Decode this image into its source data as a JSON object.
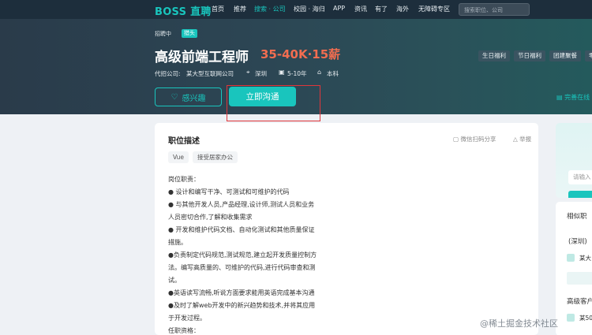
{
  "nav": {
    "logo": "BOSS 直聘",
    "items": [
      "首页",
      "推荐",
      "搜索 · 公司",
      "校园 · 海归",
      "APP",
      "资讯",
      "有了",
      "海外",
      "无障碍专区"
    ],
    "search_placeholder": "搜索职位、公司"
  },
  "job": {
    "status": "招聘中",
    "badge": "猎头",
    "title": "高级前端工程师",
    "salary": "35-40K·15薪",
    "company_label": "代招公司:",
    "company": "某大型互联网公司",
    "location": "深圳",
    "experience": "5-10年",
    "education": "本科",
    "tags": [
      "生日福利",
      "节日福利",
      "团建聚餐",
      "零"
    ]
  },
  "actions": {
    "interest": "感兴趣",
    "chat": "立即沟通",
    "complete_resume": "完善在线"
  },
  "description": {
    "title": "职位描述",
    "share": "微信扫码分享",
    "report": "举报",
    "chips": [
      "Vue",
      "接受居家办公"
    ],
    "lines": [
      "岗位职责：",
      "● 设计和编写干净、可测试和可维护的代码",
      "● 与其他开发人员,产品经理,设计师,测试人员和业务",
      "人员密切合作,了解和收集需求",
      "● 开发和维护代码文档、自动化测试和其他质量保证",
      "措施。",
      "●负责制定代码规范,测试规范,建立起开发质量控制方",
      "法。编写高质量的、可维护的代码,进行代码审查和测",
      "试。",
      "●英语读写流畅,听说方面要求能用英语完成基本沟通",
      "●及时了解web开发中的新兴趋势和技术,并将其应用",
      "于开发过程。",
      "任职资格："
    ]
  },
  "side": {
    "input_placeholder": "请输入",
    "related_title": "相似职",
    "city": "(深圳)",
    "company_short": "某大",
    "bottom_title": "高级客户",
    "bottom_item": "某50"
  },
  "watermark": "@稀土掘金技术社区",
  "colors": {
    "brand": "#19c5bd",
    "salary": "#f26d50",
    "nav_bg": "#1d2e3c",
    "highlight": "#e0363a"
  }
}
